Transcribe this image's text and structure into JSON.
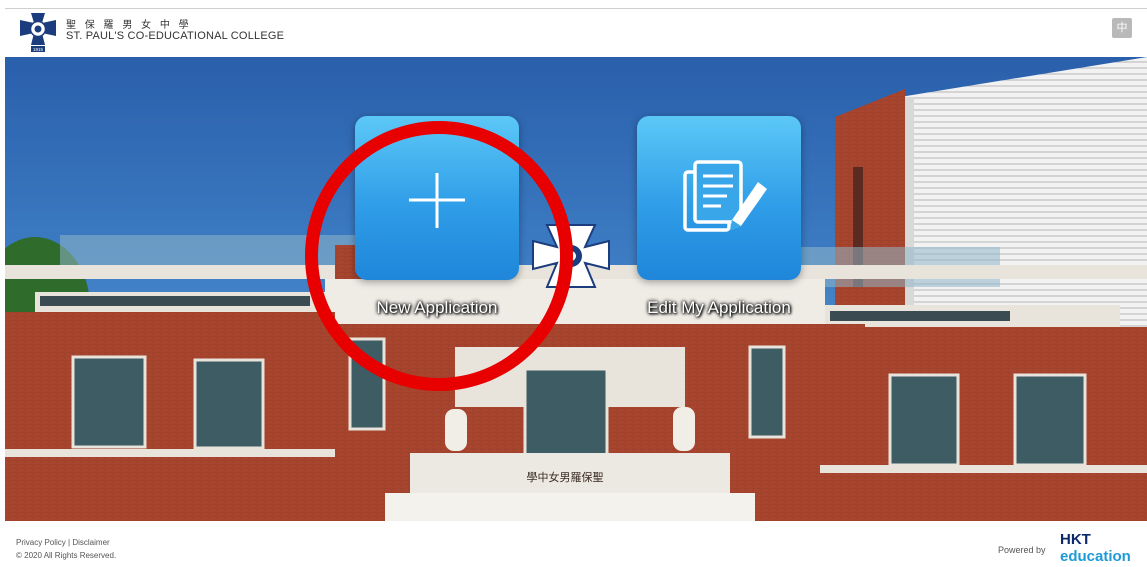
{
  "header": {
    "school_name_zh": "聖 保 羅 男 女 中 學",
    "school_name_en": "ST. PAUL'S CO-EDUCATIONAL COLLEGE",
    "language_toggle": "中",
    "logo_year": "1915"
  },
  "actions": {
    "new_application": "New Application",
    "edit_application": "Edit My Application"
  },
  "building_sign": "學中女男羅保聖",
  "footer": {
    "privacy_policy": "Privacy Policy",
    "separator": "|",
    "disclaimer": "Disclaimer",
    "copyright": "© 2020 All Rights Reserved.",
    "powered_by": "Powered by",
    "brand_top": "HKT",
    "brand_bottom": "education"
  },
  "colors": {
    "tile_top": "#5cc8f7",
    "tile_bottom": "#1f86d9",
    "highlight_circle": "#e80000",
    "brick": "#a8452f",
    "sky": "#2f6ab3",
    "brand_navy": "#0b2a6b",
    "brand_blue": "#1e9ad6"
  },
  "icons": {
    "new_application": "plus-icon",
    "edit_application": "document-edit-icon"
  }
}
